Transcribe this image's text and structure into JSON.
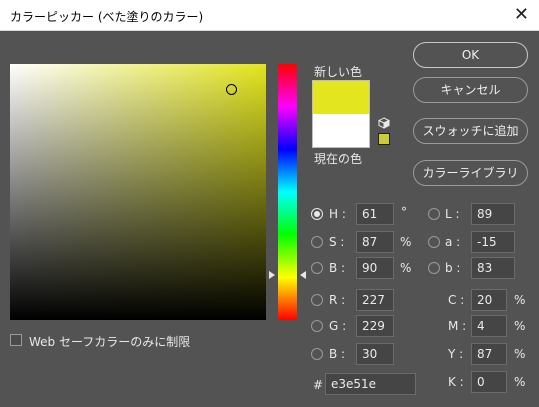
{
  "window": {
    "title": "カラーピッカー (べた塗りのカラー)"
  },
  "swatches": {
    "new_label": "新しい色",
    "current_label": "現在の色",
    "new_color": "#e3e51e",
    "current_color": "#ffffff"
  },
  "buttons": {
    "ok": "OK",
    "cancel": "キャンセル",
    "add_swatch": "スウォッチに追加",
    "color_libraries": "カラーライブラリ"
  },
  "hsb": {
    "h": {
      "label": "H :",
      "value": "61",
      "unit": "°",
      "selected": true
    },
    "s": {
      "label": "S :",
      "value": "87",
      "unit": "%"
    },
    "b": {
      "label": "B :",
      "value": "90",
      "unit": "%"
    }
  },
  "rgb": {
    "r": {
      "label": "R :",
      "value": "227"
    },
    "g": {
      "label": "G :",
      "value": "229"
    },
    "b": {
      "label": "B :",
      "value": "30"
    }
  },
  "lab": {
    "l": {
      "label": "L :",
      "value": "89"
    },
    "a": {
      "label": "a :",
      "value": "-15"
    },
    "b": {
      "label": "b :",
      "value": "83"
    }
  },
  "cmyk": {
    "c": {
      "label": "C :",
      "value": "20",
      "unit": "%"
    },
    "m": {
      "label": "M :",
      "value": "4",
      "unit": "%"
    },
    "y": {
      "label": "Y :",
      "value": "87",
      "unit": "%"
    },
    "k": {
      "label": "K :",
      "value": "0",
      "unit": "%"
    }
  },
  "hex": {
    "label": "#",
    "value": "e3e51e"
  },
  "websafe": {
    "label": "Web セーフカラーのみに制限",
    "checked": false
  }
}
